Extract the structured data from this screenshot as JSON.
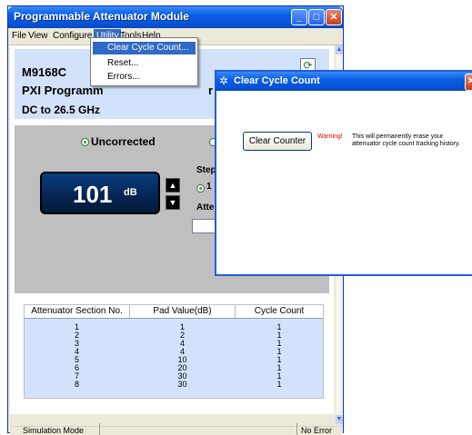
{
  "main_window": {
    "title": "Programmable Attenuator Module",
    "controls": {
      "minimize": "_",
      "maximize": "□",
      "close": "✕"
    }
  },
  "menubar": {
    "items": [
      "File",
      "View",
      "Configure",
      "Utility",
      "Tools",
      "Help"
    ],
    "active": "Utility"
  },
  "utility_menu": {
    "items": [
      "Clear Cycle Count...",
      "Reset...",
      "Errors..."
    ],
    "highlighted": "Clear Cycle Count..."
  },
  "info_panel": {
    "model": "M9168C",
    "description_prefix": "PXI Programm",
    "description_suffix": "r M",
    "frequency_range": "DC to 26.5 GHz"
  },
  "attenuator_panel": {
    "mode_uncorrected": "Uncorrected",
    "mode_selected": "Uncorrected",
    "display_value": "101",
    "display_unit": "dB",
    "step_label": "Step S",
    "step_option": "1",
    "atten_label": "Atten"
  },
  "table": {
    "headers": [
      "Attenuator Section No.",
      "Pad Value(dB)",
      "Cycle Count"
    ],
    "rows": [
      [
        "1",
        "1",
        "1"
      ],
      [
        "2",
        "2",
        "1"
      ],
      [
        "3",
        "4",
        "1"
      ],
      [
        "4",
        "4",
        "1"
      ],
      [
        "5",
        "10",
        "1"
      ],
      [
        "6",
        "20",
        "1"
      ],
      [
        "7",
        "30",
        "1"
      ],
      [
        "8",
        "30",
        "1"
      ]
    ]
  },
  "statusbar": {
    "mode": "Simulation Mode",
    "error": "No Error"
  },
  "dialog": {
    "title": "Clear Cycle Count",
    "button_label": "Clear Counter",
    "warning_label": "Warning!",
    "warning_text": "This will permanently erase your attenuator cycle count tracking history."
  },
  "colors": {
    "titlebar": "#0a5ee6",
    "info_panel_bg": "#d3e2fb",
    "attenuator_panel_bg": "#c0bfbf",
    "display_bg": "#052451",
    "menu_highlight": "#316ac5",
    "warning": "#e00000"
  }
}
